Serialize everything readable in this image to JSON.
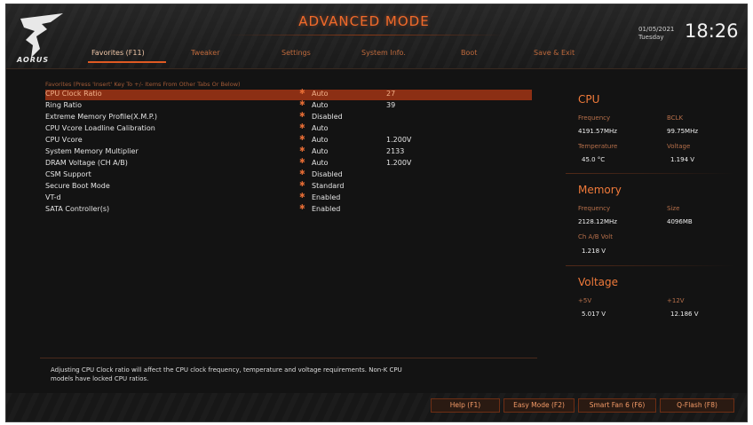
{
  "header": {
    "mode_title": "ADVANCED MODE",
    "brand": "AORUS",
    "date": "01/05/2021",
    "day": "Tuesday",
    "time": "18:26"
  },
  "tabs": [
    {
      "label": "Favorites (F11)",
      "active": true
    },
    {
      "label": "Tweaker",
      "active": false
    },
    {
      "label": "Settings",
      "active": false
    },
    {
      "label": "System Info.",
      "active": false
    },
    {
      "label": "Boot",
      "active": false
    },
    {
      "label": "Save & Exit",
      "active": false
    }
  ],
  "favorites_hint": "Favorites (Press 'Insert' Key To +/- Items From Other Tabs Or Below)",
  "settings": [
    {
      "name": "CPU Clock Ratio",
      "value": "Auto",
      "extra": "27",
      "selected": true
    },
    {
      "name": "Ring Ratio",
      "value": "Auto",
      "extra": "39",
      "selected": false
    },
    {
      "name": "Extreme Memory Profile(X.M.P.)",
      "value": "Disabled",
      "extra": "",
      "selected": false
    },
    {
      "name": "CPU Vcore Loadline Calibration",
      "value": "Auto",
      "extra": "",
      "selected": false
    },
    {
      "name": "CPU Vcore",
      "value": "Auto",
      "extra": "1.200V",
      "selected": false
    },
    {
      "name": "System Memory Multiplier",
      "value": "Auto",
      "extra": "2133",
      "selected": false
    },
    {
      "name": "DRAM Voltage    (CH A/B)",
      "value": "Auto",
      "extra": "1.200V",
      "selected": false
    },
    {
      "name": "CSM Support",
      "value": "Disabled",
      "extra": "",
      "selected": false
    },
    {
      "name": "Secure Boot Mode",
      "value": "Standard",
      "extra": "",
      "selected": false
    },
    {
      "name": "VT-d",
      "value": "Enabled",
      "extra": "",
      "selected": false
    },
    {
      "name": "SATA Controller(s)",
      "value": "Enabled",
      "extra": "",
      "selected": false
    }
  ],
  "help_text": "Adjusting CPU Clock ratio will affect the CPU clock frequency, temperature and voltage requirements. Non-K CPU models have locked CPU ratios.",
  "side": {
    "cpu": {
      "title": "CPU",
      "frequency_label": "Frequency",
      "frequency_value": "4191.57MHz",
      "bclk_label": "BCLK",
      "bclk_value": "99.75MHz",
      "temperature_label": "Temperature",
      "temperature_value": "45.0 °C",
      "voltage_label": "Voltage",
      "voltage_value": "1.194 V"
    },
    "memory": {
      "title": "Memory",
      "frequency_label": "Frequency",
      "frequency_value": "2128.12MHz",
      "size_label": "Size",
      "size_value": "4096MB",
      "volt_label": "Ch A/B Volt",
      "volt_value": "1.218 V"
    },
    "voltage": {
      "title": "Voltage",
      "v5_label": "+5V",
      "v5_value": "5.017 V",
      "v12_label": "+12V",
      "v12_value": "12.186 V"
    }
  },
  "bottom_buttons": [
    {
      "label": "Help (F1)"
    },
    {
      "label": "Easy Mode (F2)"
    },
    {
      "label": "Smart Fan 6 (F6)"
    },
    {
      "label": "Q-Flash (F8)"
    }
  ],
  "colors": {
    "accent": "#e05a22",
    "selected_row": "#8c2f14",
    "background": "#131313"
  }
}
